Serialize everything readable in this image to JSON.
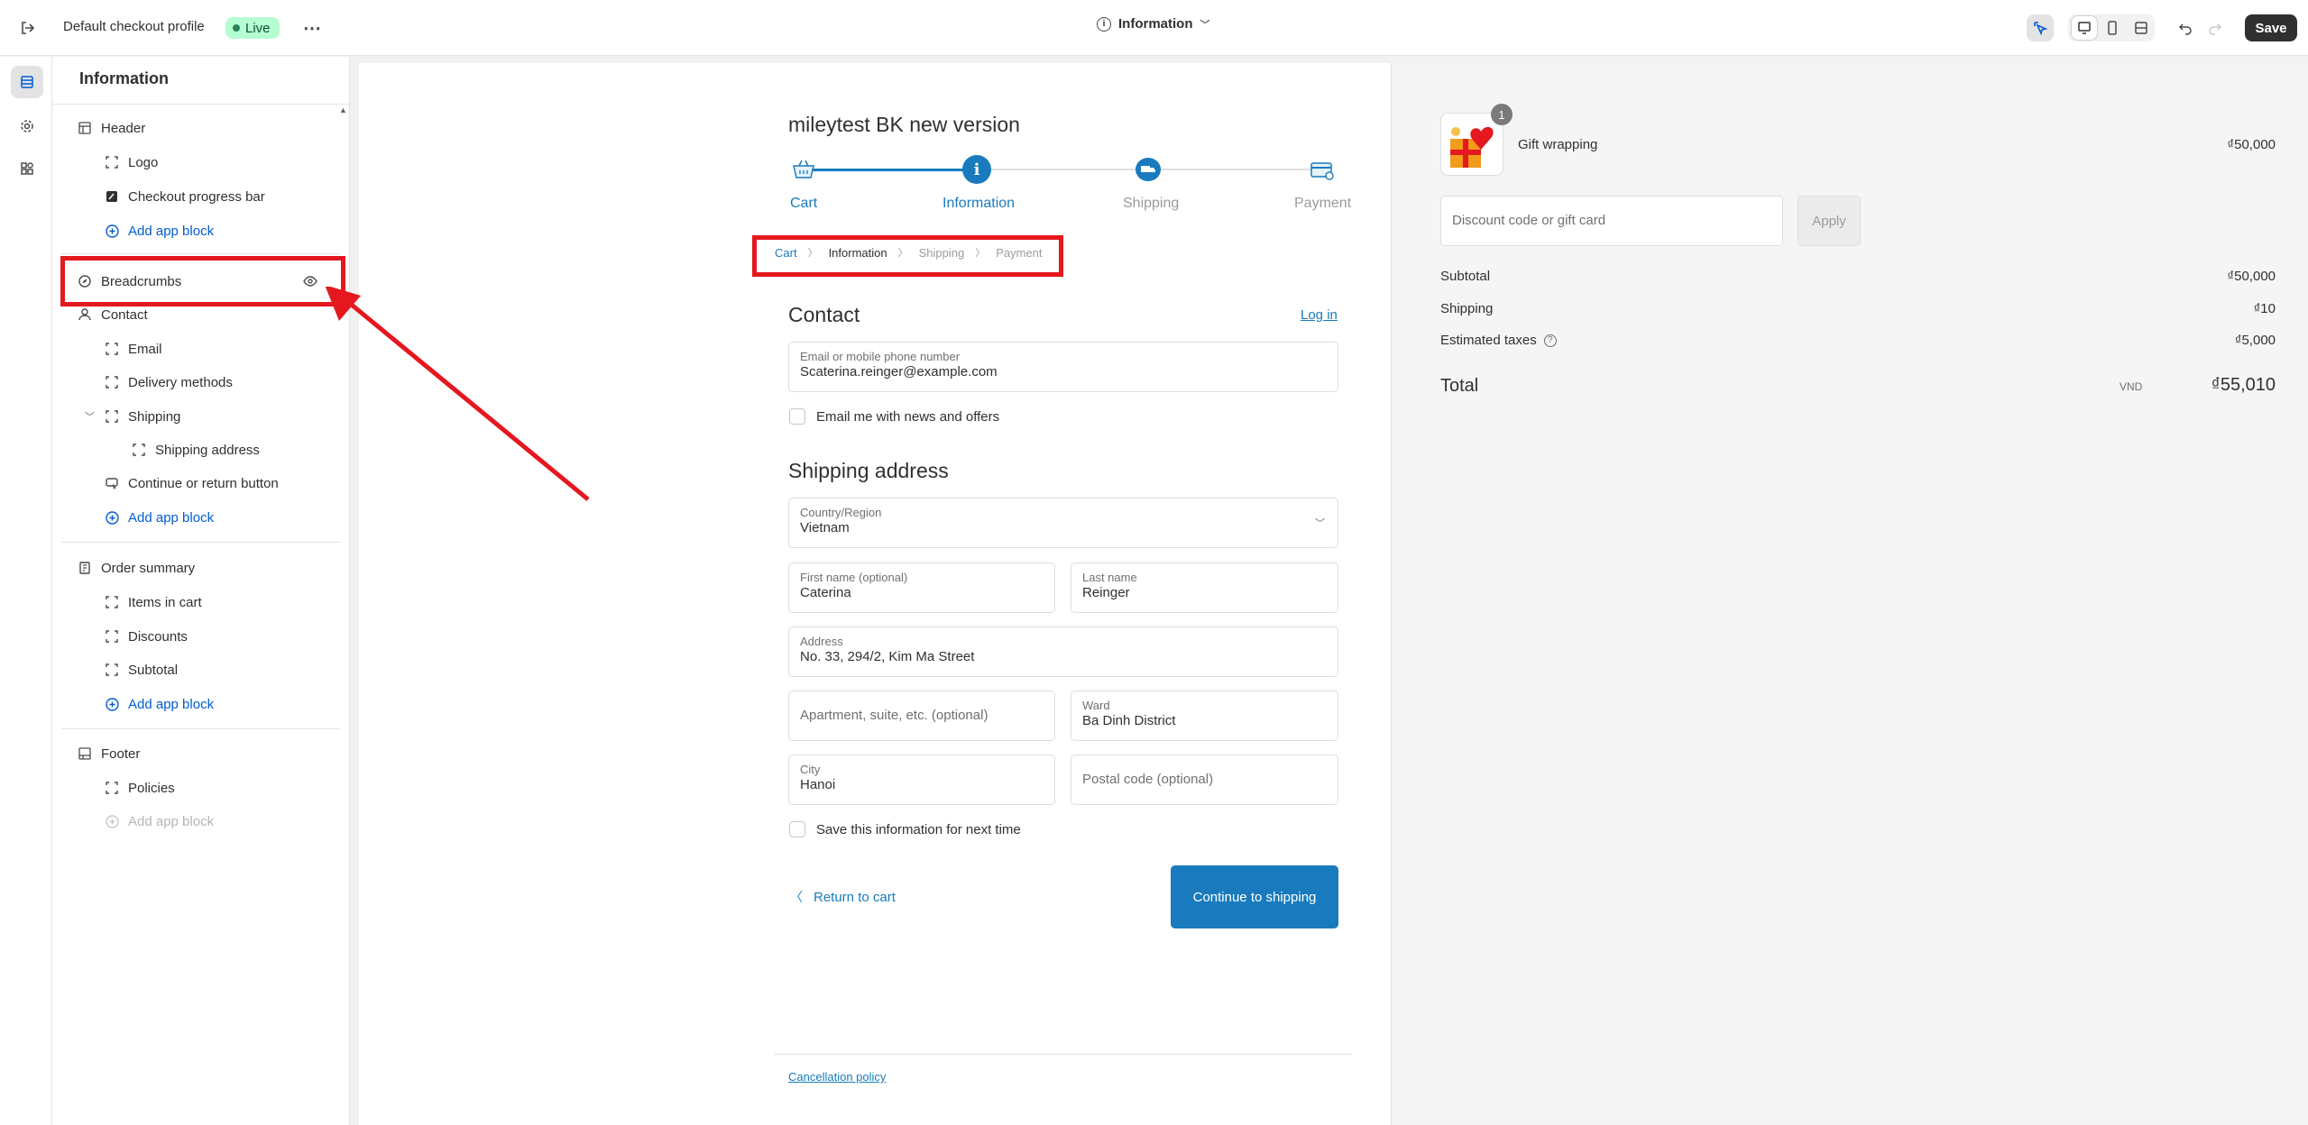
{
  "topbar": {
    "profile_name": "Default checkout profile",
    "live_label": "Live",
    "page_select": "Information",
    "save_label": "Save"
  },
  "sidebar": {
    "title": "Information",
    "sections": {
      "header": {
        "label": "Header",
        "items": [
          "Logo",
          "Checkout progress bar"
        ],
        "add": "Add app block"
      },
      "breadcrumbs": "Breadcrumbs",
      "contact": {
        "label": "Contact",
        "items": [
          "Email",
          "Delivery methods"
        ]
      },
      "shipping": {
        "label": "Shipping",
        "child": "Shipping address"
      },
      "continue": "Continue or return button",
      "add_main": "Add app block",
      "order_summary": {
        "label": "Order summary",
        "items": [
          "Items in cart",
          "Discounts",
          "Subtotal"
        ],
        "add": "Add app block"
      },
      "footer": {
        "label": "Footer",
        "items": [
          "Policies"
        ],
        "add": "Add app block"
      }
    }
  },
  "checkout": {
    "shop_name": "mileytest BK new version",
    "steps": [
      "Cart",
      "Information",
      "Shipping",
      "Payment"
    ],
    "breadcrumbs": [
      "Cart",
      "Information",
      "Shipping",
      "Payment"
    ],
    "contact_heading": "Contact",
    "login_link": "Log in",
    "email_label": "Email or mobile phone number",
    "email_value": "Scaterina.reinger@example.com",
    "news_opt": "Email me with news and offers",
    "shipping_heading": "Shipping address",
    "country_label": "Country/Region",
    "country_value": "Vietnam",
    "first_label": "First name (optional)",
    "first_value": "Caterina",
    "last_label": "Last name",
    "last_value": "Reinger",
    "address_label": "Address",
    "address_value": "No. 33, 294/2, Kim Ma Street",
    "apt_placeholder": "Apartment, suite, etc. (optional)",
    "ward_label": "Ward",
    "ward_value": "Ba Dinh District",
    "city_label": "City",
    "city_value": "Hanoi",
    "postal_placeholder": "Postal code (optional)",
    "save_info": "Save this information for next time",
    "return_link": "Return to cart",
    "continue_button": "Continue to shipping",
    "policy_link": "Cancellation policy"
  },
  "summary": {
    "item_name": "Gift wrapping",
    "item_qty": "1",
    "item_price": "₫50,000",
    "discount_placeholder": "Discount code or gift card",
    "apply_label": "Apply",
    "subtotal_label": "Subtotal",
    "subtotal_value": "₫50,000",
    "shipping_label": "Shipping",
    "shipping_value": "₫10",
    "taxes_label": "Estimated taxes",
    "taxes_value": "₫5,000",
    "total_label": "Total",
    "currency": "VND",
    "total_value": "₫55,010"
  },
  "colors": {
    "accent": "#197bbd",
    "highlight": "#e5171f",
    "link": "#005bd3"
  }
}
